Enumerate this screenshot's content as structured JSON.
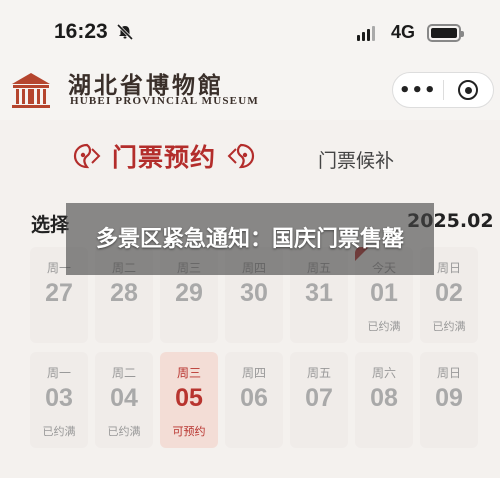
{
  "status_bar": {
    "time": "16:23",
    "network": "4G"
  },
  "header": {
    "name_cn": "湖北省博物館",
    "name_en": "HUBEI PROVINCIAL MUSEUM",
    "more_label": "•••"
  },
  "tabs": [
    {
      "label": "门票预约",
      "active": true
    },
    {
      "label": "门票候补",
      "active": false
    }
  ],
  "date_row": {
    "select_label": "选择",
    "date_label": "2025.02"
  },
  "banner": {
    "text": "多景区紧急通知：国庆门票售罄"
  },
  "calendar": {
    "accent_color": "#b32d2b",
    "rows": [
      [
        {
          "dow": "周一",
          "num": "27",
          "status": ""
        },
        {
          "dow": "周二",
          "num": "28",
          "status": ""
        },
        {
          "dow": "周三",
          "num": "29",
          "status": ""
        },
        {
          "dow": "周四",
          "num": "30",
          "status": ""
        },
        {
          "dow": "周五",
          "num": "31",
          "status": ""
        },
        {
          "dow": "今天",
          "num": "01",
          "status": "已约满"
        },
        {
          "dow": "周日",
          "num": "02",
          "status": "已约满"
        }
      ],
      [
        {
          "dow": "周一",
          "num": "03",
          "status": "已约满"
        },
        {
          "dow": "周二",
          "num": "04",
          "status": "已约满"
        },
        {
          "dow": "周三",
          "num": "05",
          "status": "可预约"
        },
        {
          "dow": "周四",
          "num": "06",
          "status": ""
        },
        {
          "dow": "周五",
          "num": "07",
          "status": ""
        },
        {
          "dow": "周六",
          "num": "08",
          "status": ""
        },
        {
          "dow": "周日",
          "num": "09",
          "status": ""
        }
      ]
    ]
  }
}
